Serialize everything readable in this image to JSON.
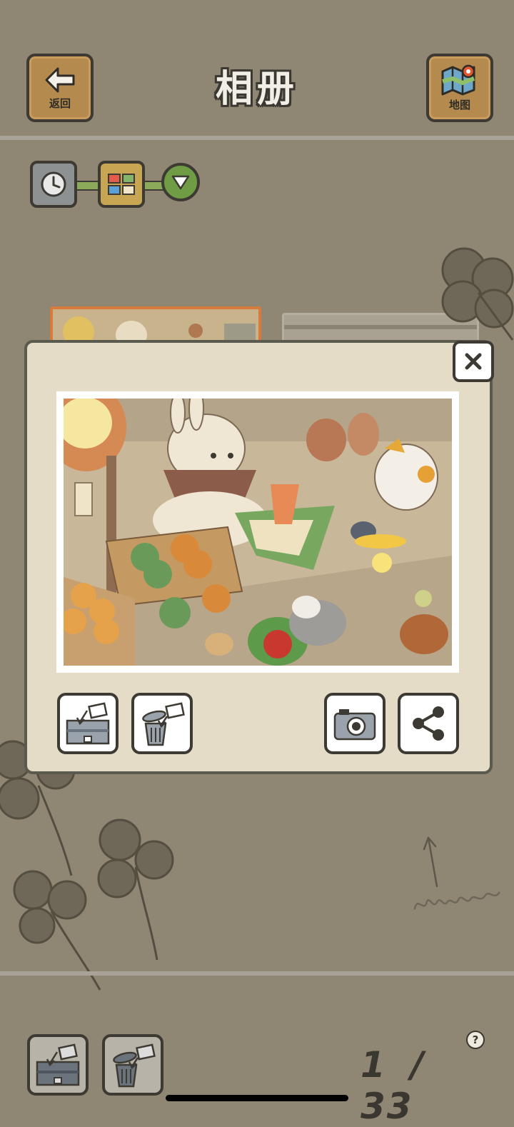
{
  "header": {
    "title": "相册",
    "back_label": "返回",
    "map_label": "地图"
  },
  "sort_toggle": {
    "options": [
      "time-icon",
      "grid-icon",
      "dropdown-icon"
    ],
    "active": "grid-icon"
  },
  "photo_viewer": {
    "close_icon": "close-icon",
    "actions": [
      "save-to-box-icon",
      "trash-icon",
      "camera-icon",
      "share-icon"
    ]
  },
  "footer": {
    "page_current": "1",
    "page_separator": "/",
    "page_total": "33",
    "help_label": "?"
  },
  "colors": {
    "background": "#8f8774",
    "modal": "#e4dcc7",
    "wood": "#b58a4f",
    "accent_green": "#8bab5a"
  }
}
